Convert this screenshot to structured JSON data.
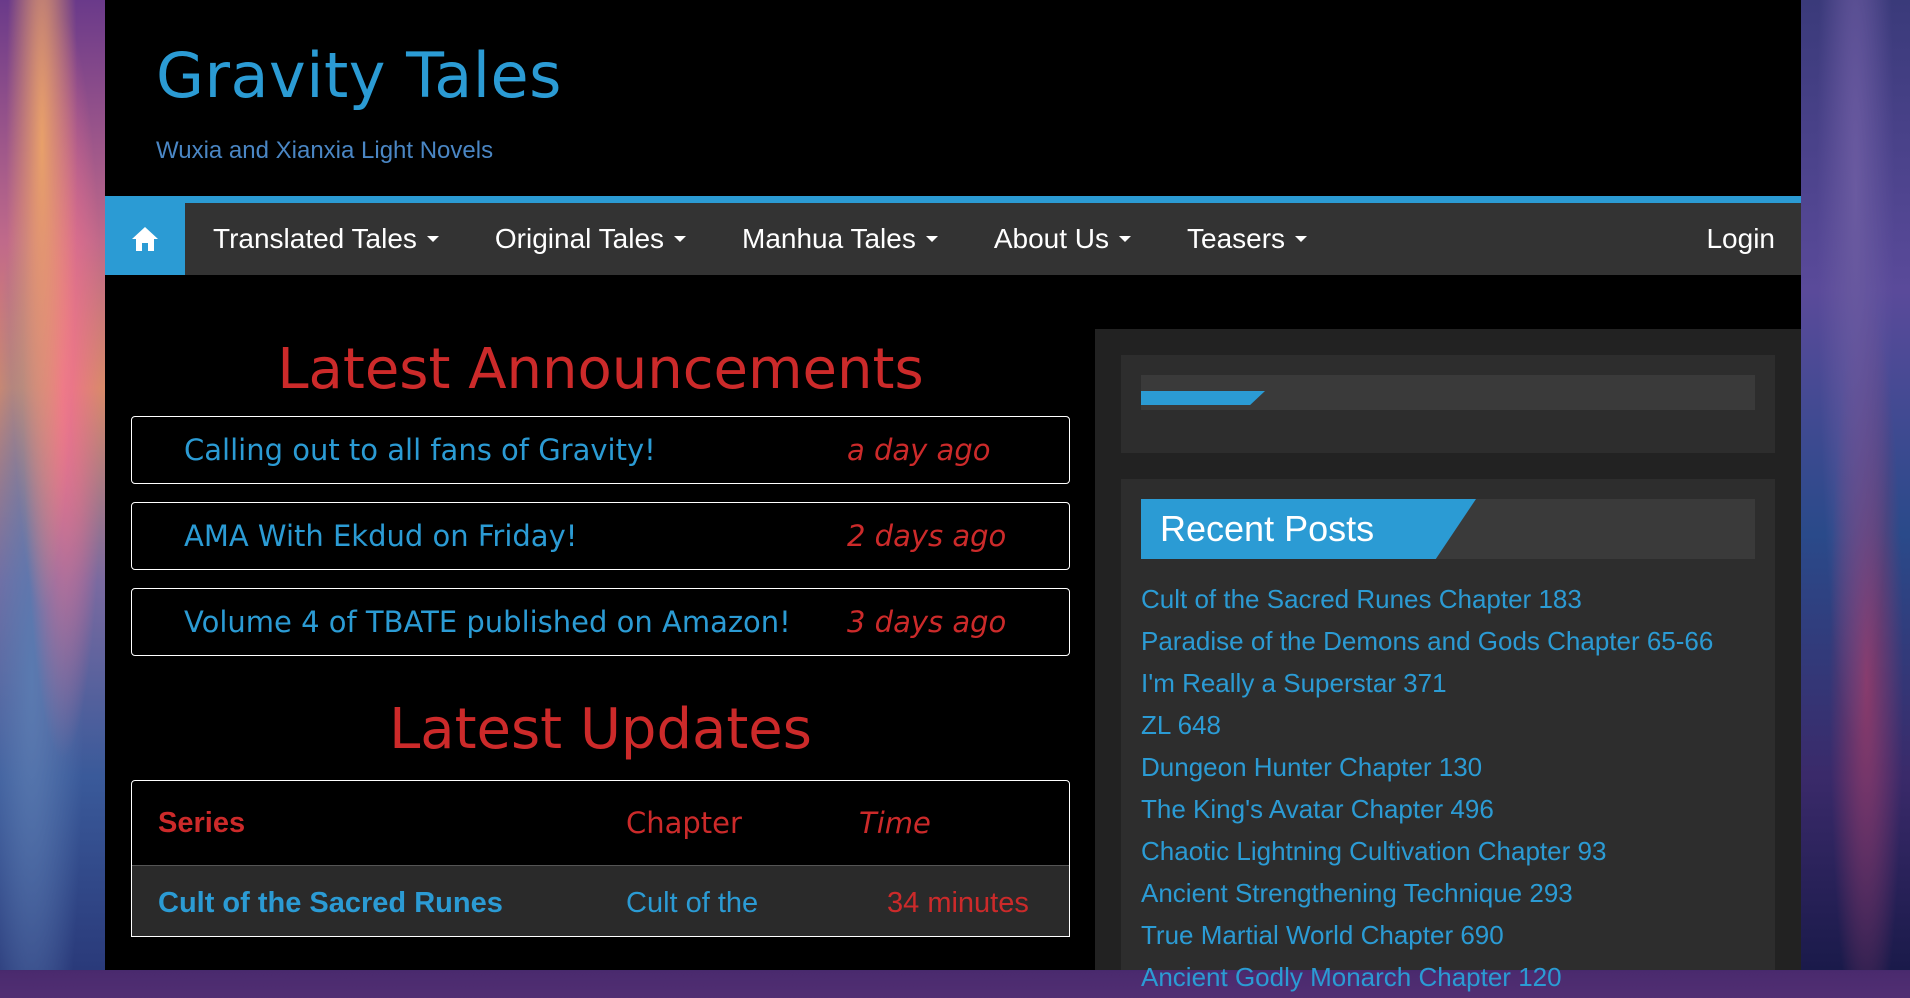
{
  "site": {
    "title": "Gravity Tales",
    "tagline": "Wuxia and Xianxia Light Novels"
  },
  "nav": {
    "home_icon": "home-icon",
    "items": [
      {
        "label": "Translated Tales"
      },
      {
        "label": "Original Tales"
      },
      {
        "label": "Manhua Tales"
      },
      {
        "label": "About Us"
      },
      {
        "label": "Teasers"
      }
    ],
    "login": "Login"
  },
  "announcements": {
    "title": "Latest Announcements",
    "items": [
      {
        "title": "Calling out to all fans of Gravity!",
        "time": "a day ago"
      },
      {
        "title": "AMA With Ekdud on Friday!",
        "time": "2 days ago"
      },
      {
        "title": "Volume 4 of TBATE published on Amazon!",
        "time": "3 days ago"
      }
    ]
  },
  "updates": {
    "title": "Latest Updates",
    "headers": {
      "series": "Series",
      "chapter": "Chapter",
      "time": "Time"
    },
    "rows": [
      {
        "series": "Cult of the Sacred Runes",
        "chapter": "Cult of the",
        "time": "34 minutes"
      }
    ]
  },
  "sidebar": {
    "recent_posts_title": "Recent Posts",
    "recent_posts": [
      "Cult of the Sacred Runes Chapter 183",
      "Paradise of the Demons and Gods Chapter 65-66",
      "I'm Really a Superstar 371",
      "ZL 648",
      "Dungeon Hunter Chapter 130",
      "The King's Avatar Chapter 496",
      "Chaotic Lightning Cultivation Chapter 93",
      "Ancient Strengthening Technique 293",
      "True Martial World Chapter 690",
      "Ancient Godly Monarch Chapter 120"
    ]
  },
  "colors": {
    "accent": "#2b9bd4",
    "heading_red": "#cc2a2a",
    "nav_bg": "#333333"
  }
}
